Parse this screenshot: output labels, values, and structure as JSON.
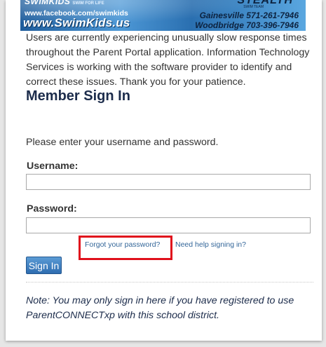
{
  "banner": {
    "brand_top": "SWIMKIDS",
    "brand_tag": "SWIM FOR LIFE",
    "facebook": "www.facebook.com/swimkids",
    "url": "www.SwimKids.us",
    "right_logo": "STEALTH",
    "right_sub": "SWIM TEAM",
    "gainesville": "Gainesville 571-261-7946",
    "woodbridge": "Woodbridge 703-396-7946",
    "colors": {
      "background": "#2a6fb0",
      "dark_text": "#0d2340"
    }
  },
  "notice": "Users are currently experiencing unusually slow response times throughout the Parent Portal application. Information Technology Services is working with the software provider to identify and correct these issues. Thank you for your patience.",
  "signin": {
    "title": "Member Sign In",
    "prompt": "Please enter your username and password.",
    "username_label": "Username:",
    "username_value": "",
    "password_label": "Password:",
    "password_value": "",
    "forgot_link": "Forgot your password?",
    "help_link": "Need help signing in?",
    "button_label": "Sign In"
  },
  "note": "Note: You may only sign in here if you have registered to use ParentCONNECTxp with this school district.",
  "colors": {
    "title": "#1c2c4b",
    "link": "#336699",
    "button": "#2e6db0",
    "highlight": "#e0101c"
  }
}
